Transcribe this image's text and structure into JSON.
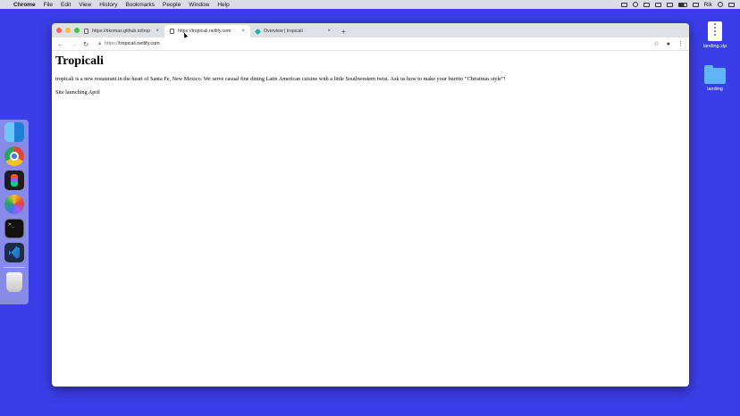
{
  "menubar": {
    "apple_icon": "apple-icon",
    "items": [
      "Chrome",
      "File",
      "Edit",
      "View",
      "History",
      "Bookmarks",
      "People",
      "Window",
      "Help"
    ],
    "user": "Rik"
  },
  "browser": {
    "tabs": [
      {
        "title": "https://rikomas.github.io/trop",
        "close": "×"
      },
      {
        "title": "https://tropicali.netlify.com",
        "close": "×"
      },
      {
        "title": "Overview | tropicali",
        "close": "×"
      }
    ],
    "new_tab": "+",
    "url_scheme": "https://",
    "url_host": "tropicali.netlify.com"
  },
  "page": {
    "heading": "Tropicali",
    "description": "tropicali is a new restaurant in the heart of Santa Fe, New Mexico. We serve casual fine dining Latin American cuisine with a little Southwestern twist. Ask us how to make your burrito “Christmas style”!",
    "launch": "Site launching April"
  },
  "desktop": {
    "icons": [
      {
        "label": "landing.zip"
      },
      {
        "label": "landing"
      }
    ]
  },
  "dock": {
    "apps": [
      "finder-icon",
      "chrome-icon",
      "figma-icon",
      "photos-icon",
      "terminal-icon",
      "vscode-icon",
      "trash-icon"
    ]
  }
}
